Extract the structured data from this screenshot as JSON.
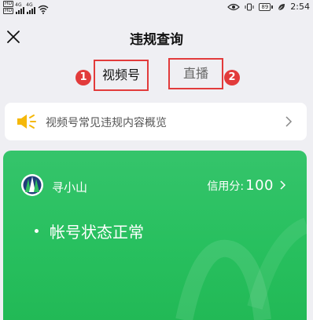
{
  "status_bar": {
    "sim1_label": "HD",
    "sim2_label": "HD",
    "net1": "4G",
    "net2": "4G",
    "battery": "89",
    "time": "2:54"
  },
  "header": {
    "title": "违规查询"
  },
  "tabs": [
    {
      "label": "视频号",
      "marker": "1",
      "selected": true
    },
    {
      "label": "直播",
      "marker": "2",
      "selected": false
    }
  ],
  "notice": {
    "text": "视频号常见违规内容概览"
  },
  "account_card": {
    "name": "寻小山",
    "credit_label": "信用分:",
    "credit_score": "100",
    "status": "帐号状态正常"
  },
  "colors": {
    "accent_red": "#e23b3b",
    "card_green": "#2cc162",
    "speaker_yellow": "#f5b80a"
  }
}
